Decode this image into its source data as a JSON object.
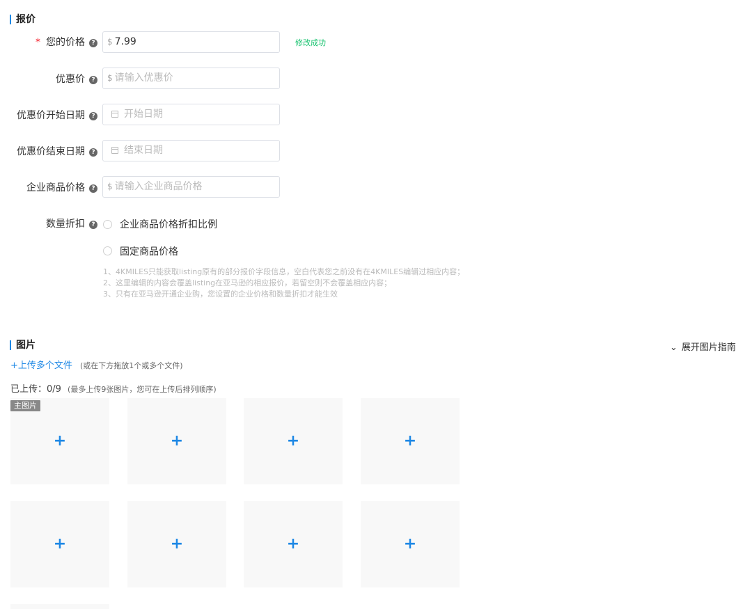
{
  "pricing": {
    "title": "报价",
    "your_price": {
      "label": "您的价格",
      "required_mark": "*",
      "prefix": "$",
      "value": "7.99",
      "status": "修改成功"
    },
    "sale_price": {
      "label": "优惠价",
      "prefix": "$",
      "placeholder": "请输入优惠价"
    },
    "sale_start": {
      "label": "优惠价开始日期",
      "placeholder": "开始日期"
    },
    "sale_end": {
      "label": "优惠价结束日期",
      "placeholder": "结束日期"
    },
    "business_price": {
      "label": "企业商品价格",
      "prefix": "$",
      "placeholder": "请输入企业商品价格"
    },
    "quantity_discount": {
      "label": "数量折扣",
      "options": [
        "企业商品价格折扣比例",
        "固定商品价格"
      ]
    },
    "notes": [
      "1、4KMILES只能获取listing原有的部分报价字段信息，空白代表您之前没有在4KMILES编辑过相应内容；",
      "2、这里编辑的内容会覆盖listing在亚马逊的相应报价，若留空则不会覆盖相应内容；",
      "3、只有在亚马逊开通企业购，您设置的企业价格和数量折扣才能生效"
    ],
    "help_glyph": "?"
  },
  "images": {
    "title": "图片",
    "expand_label": "展开图片指南",
    "upload_link": "+上传多个文件",
    "upload_hint": "(或在下方拖放1个或多个文件)",
    "uploaded_label": "已上传：0/9",
    "uploaded_hint": "(最多上传9张图片，您可在上传后排列顺序)",
    "main_tag": "主图片",
    "slot_glyph": "+",
    "expand_glyph": "⌄"
  }
}
